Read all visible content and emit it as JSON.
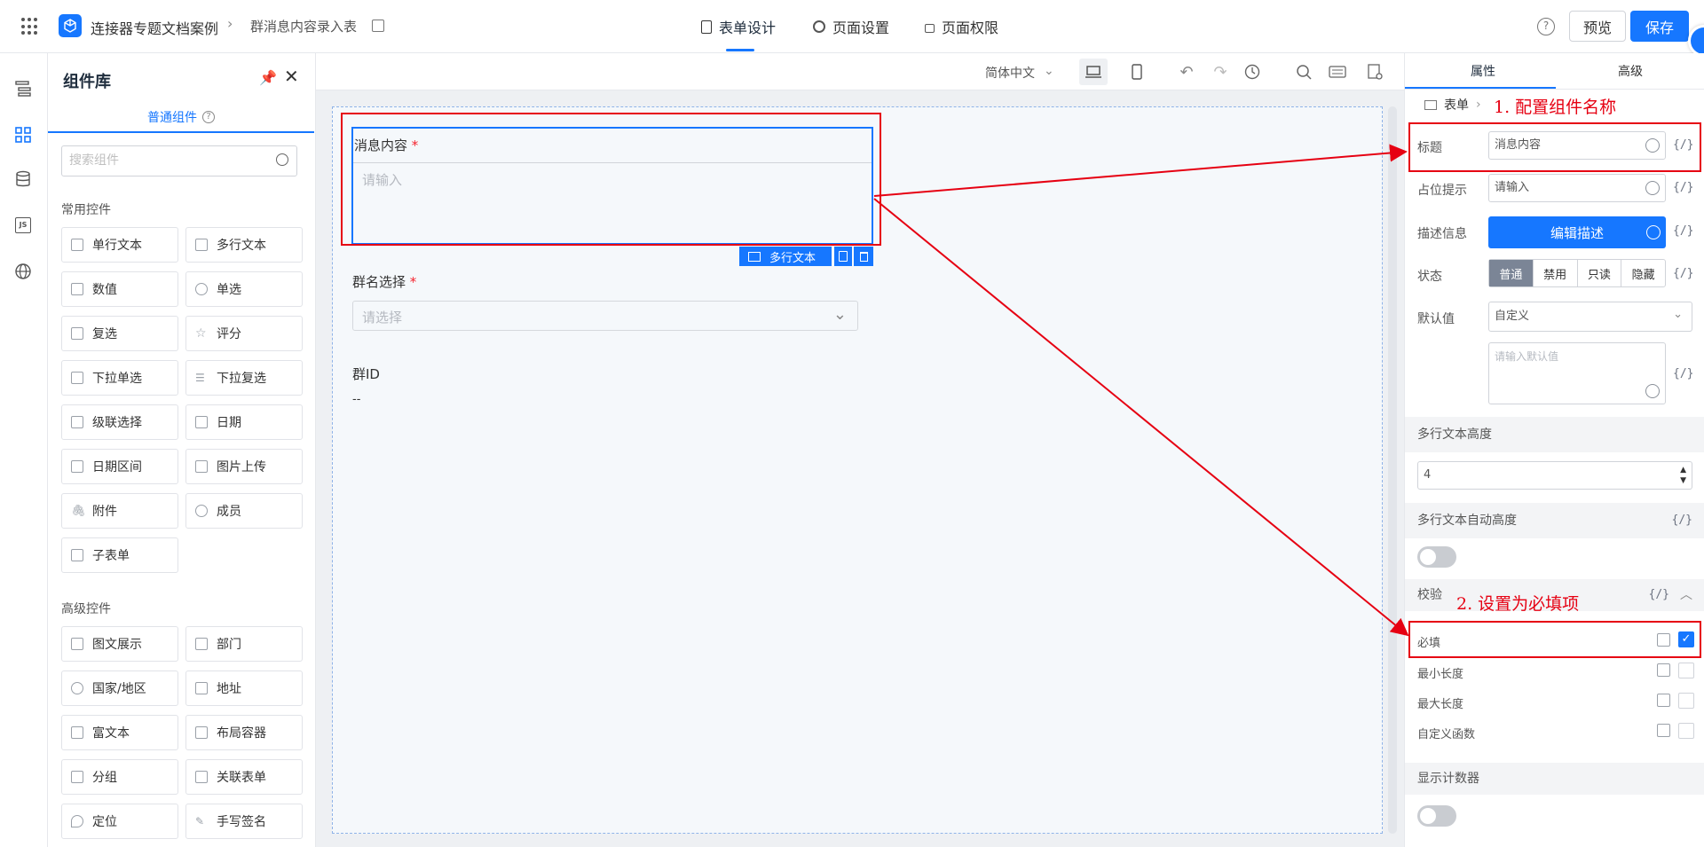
{
  "header": {
    "app_name": "连接器专题文档案例",
    "page_name": "群消息内容录入表",
    "tabs": [
      {
        "label": "表单设计"
      },
      {
        "label": "页面设置"
      },
      {
        "label": "页面权限"
      }
    ],
    "preview_label": "预览",
    "save_label": "保存"
  },
  "library": {
    "title": "组件库",
    "tab_label": "普通组件",
    "search_placeholder": "搜索组件",
    "common_title": "常用控件",
    "common": [
      "单行文本",
      "多行文本",
      "数值",
      "单选",
      "复选",
      "评分",
      "下拉单选",
      "下拉复选",
      "级联选择",
      "日期",
      "日期区间",
      "图片上传",
      "附件",
      "成员",
      "子表单"
    ],
    "advanced_title": "高级控件",
    "advanced": [
      "图文展示",
      "部门",
      "国家/地区",
      "地址",
      "富文本",
      "布局容器",
      "分组",
      "关联表单",
      "定位",
      "手写签名"
    ]
  },
  "toolbar": {
    "language": "简体中文"
  },
  "canvas": {
    "fields": [
      {
        "label": "消息内容",
        "required": "*",
        "placeholder": "请输入",
        "type_tag": "多行文本"
      },
      {
        "label": "群名选择",
        "required": "*",
        "placeholder": "请选择"
      },
      {
        "label": "群ID",
        "value": "--"
      }
    ]
  },
  "props": {
    "tabs": [
      "属性",
      "高级"
    ],
    "breadcrumb": "表单",
    "title_label": "标题",
    "title_value": "消息内容",
    "placeholder_label": "占位提示",
    "placeholder_value": "请输入",
    "desc_label": "描述信息",
    "desc_button": "编辑描述",
    "state_label": "状态",
    "states": [
      "普通",
      "禁用",
      "只读",
      "隐藏"
    ],
    "default_label": "默认值",
    "default_mode": "自定义",
    "default_placeholder": "请输入默认值",
    "height_label": "多行文本高度",
    "height_value": "4",
    "auto_height_label": "多行文本自动高度",
    "validate_label": "校验",
    "rules": [
      "必填",
      "最小长度",
      "最大长度",
      "自定义函数"
    ],
    "counter_label": "显示计数器",
    "fx": "{/}"
  },
  "annotations": {
    "a1": "1. 配置组件名称",
    "a2": "2. 设置为必填项"
  },
  "colors": {
    "primary": "#1677ff",
    "annotation": "#e60012"
  }
}
